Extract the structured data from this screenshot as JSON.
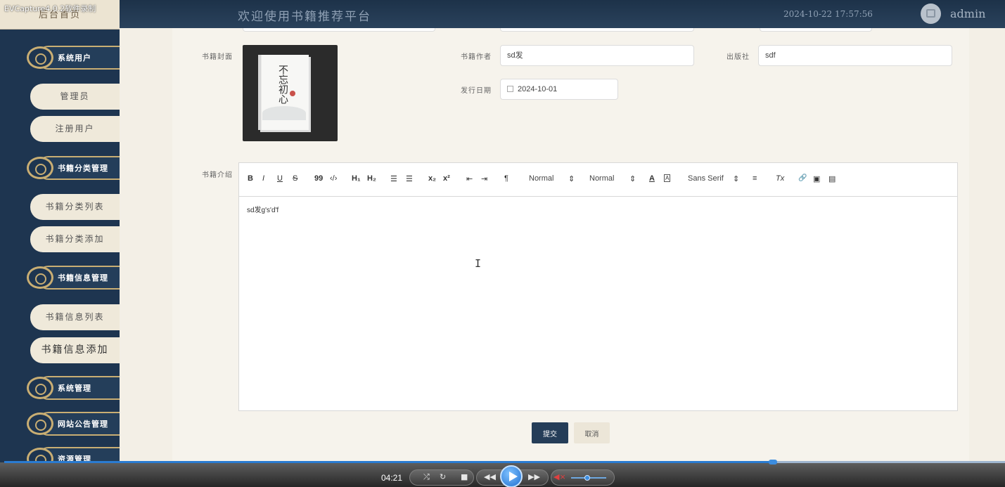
{
  "recorder": {
    "watermark": "EVCapture4.0.2软件录制"
  },
  "header": {
    "home": "后台首页",
    "welcome": "欢迎使用书籍推荐平台",
    "datetime": "2024-10-22 17:57:56",
    "username": "admin"
  },
  "sidebar": {
    "groups": [
      {
        "label": "系统用户",
        "items": [
          "管理员",
          "注册用户"
        ]
      },
      {
        "label": "书籍分类管理",
        "items": [
          "书籍分类列表",
          "书籍分类添加"
        ]
      },
      {
        "label": "书籍信息管理",
        "items": [
          "书籍信息列表",
          "书籍信息添加"
        ]
      },
      {
        "label": "系统管理",
        "items": []
      },
      {
        "label": "网站公告管理",
        "items": []
      },
      {
        "label": "资源管理",
        "items": []
      }
    ],
    "active_item": "书籍信息添加"
  },
  "form": {
    "cover_label": "书籍封面",
    "cover_title": "不忘初心",
    "author_label": "书籍作者",
    "author_value": "sd发",
    "publisher_label": "出版社",
    "publisher_value": "sdf",
    "date_label": "发行日期",
    "date_value": "2024-10-01",
    "intro_label": "书籍介绍",
    "intro_content": "sd发g's'd'f",
    "submit": "提交",
    "cancel": "取消"
  },
  "editor_toolbar": {
    "bold": "B",
    "italic": "I",
    "underline": "U",
    "strike": "S",
    "quote": "99",
    "code": "‹/›",
    "h1": "H₁",
    "h2": "H₂",
    "ordered_list": "☰",
    "bullet_list": "☰",
    "sub": "x₂",
    "sup": "x²",
    "indent_decrease": "⇤",
    "indent_increase": "⇥",
    "direction": "¶",
    "size_select": "Normal",
    "header_select": "Normal",
    "color": "A",
    "background": "A",
    "font_select": "Sans Serif",
    "align": "≡",
    "clean": "Tx",
    "link": "🔗",
    "image": "▣",
    "video": "▤"
  },
  "player": {
    "time": "04:21",
    "progress": 0.768,
    "volume": 0.45
  }
}
